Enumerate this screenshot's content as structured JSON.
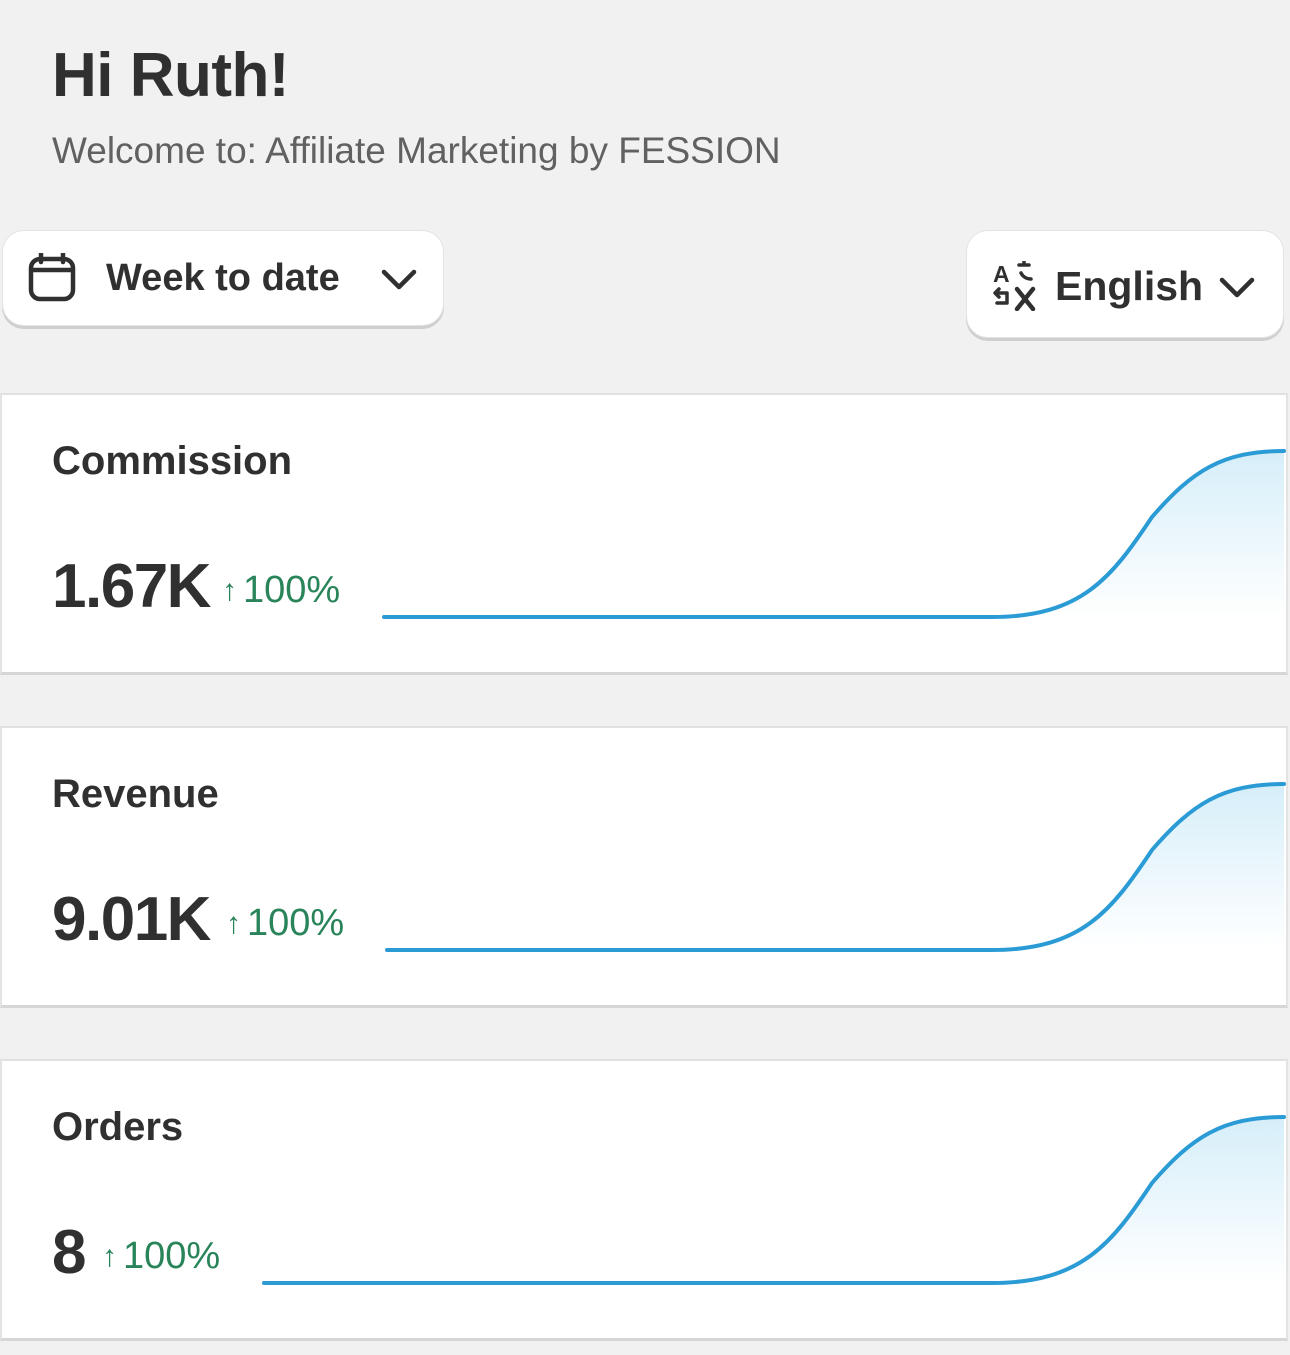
{
  "header": {
    "greeting": "Hi Ruth!",
    "welcome": "Welcome to: Affiliate Marketing by FESSION"
  },
  "controls": {
    "date_range": {
      "label": "Week to date",
      "icon": "calendar-icon"
    },
    "language": {
      "label": "English",
      "icon": "translate-icon"
    }
  },
  "metrics": [
    {
      "title": "Commission",
      "value": "1.67K",
      "change": "100%",
      "direction": "up"
    },
    {
      "title": "Revenue",
      "value": "9.01K",
      "change": "100%",
      "direction": "up"
    },
    {
      "title": "Orders",
      "value": "8",
      "change": "100%",
      "direction": "up"
    }
  ],
  "colors": {
    "page_bg": "#f1f1f1",
    "card_bg": "#ffffff",
    "text": "#303030",
    "muted_text": "#616161",
    "positive": "#29845a",
    "sparkline": "#2b9bd6",
    "sparkline_fill": "#d6eef9"
  }
}
